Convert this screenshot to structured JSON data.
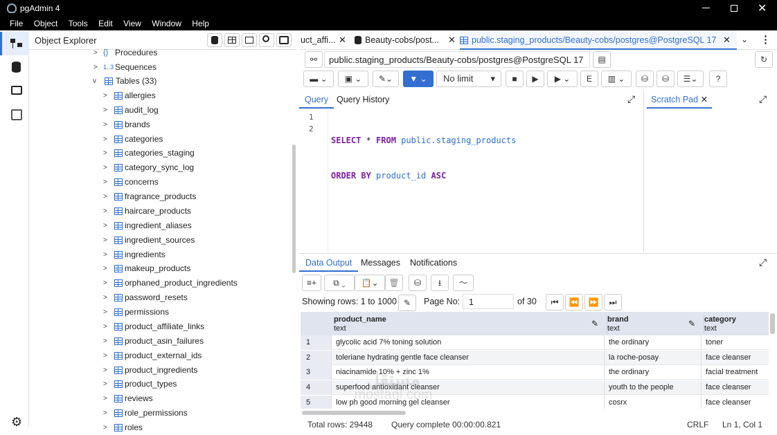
{
  "window": {
    "title": "pgAdmin 4"
  },
  "menu": [
    "File",
    "Object",
    "Tools",
    "Edit",
    "View",
    "Window",
    "Help"
  ],
  "explorer": {
    "title": "Object Explorer",
    "nodes": {
      "procedures": "Procedures",
      "sequences_badge": "1..3",
      "sequences": "Sequences",
      "tables": "Tables (33)"
    },
    "tables": [
      "allergies",
      "audit_log",
      "brands",
      "categories",
      "categories_staging",
      "category_sync_log",
      "concerns",
      "fragrance_products",
      "haircare_products",
      "ingredient_aliases",
      "ingredient_sources",
      "ingredients",
      "makeup_products",
      "orphaned_product_ingredients",
      "password_resets",
      "permissions",
      "product_affiliate_links",
      "product_asin_failures",
      "product_external_ids",
      "product_ingredients",
      "product_types",
      "reviews",
      "role_permissions",
      "roles"
    ]
  },
  "tabs": [
    {
      "label": "uct_affi..."
    },
    {
      "label": "Beauty-cobs/post..."
    },
    {
      "label": "public.staging_products/Beauty-cobs/postgres@PostgreSQL 17"
    }
  ],
  "connection": {
    "label": "public.staging_products/Beauty-cobs/postgres@PostgreSQL 17"
  },
  "toolbar": {
    "limit": "No limit"
  },
  "editor": {
    "tabs": {
      "query": "Query",
      "history": "Query History"
    },
    "line_numbers": [
      "1",
      "2"
    ],
    "line1": {
      "kw1": "SELECT",
      "op": " * ",
      "kw2": "FROM",
      "obj": " public.staging_products"
    },
    "line2": {
      "kw1": "ORDER BY",
      "col": " product_id ",
      "kw2": "ASC"
    }
  },
  "scratch": {
    "title": "Scratch Pad"
  },
  "output": {
    "tabs": {
      "data": "Data Output",
      "messages": "Messages",
      "notifications": "Notifications"
    },
    "showing_label": "Showing rows:",
    "showing_value": "1 to 1000",
    "page_label": "Page No:",
    "page_value": "1",
    "of_pages": "of 30",
    "columns": [
      {
        "name": "product_name",
        "type": "text"
      },
      {
        "name": "brand",
        "type": "text"
      },
      {
        "name": "category",
        "type": "text"
      }
    ],
    "rows": [
      {
        "n": "1",
        "product_name": "glycolic acid 7% toning solution",
        "brand": "the ordinary",
        "category": "toner"
      },
      {
        "n": "2",
        "product_name": "toleriane hydrating gentle face cleanser",
        "brand": "la roche-posay",
        "category": "face cleanser"
      },
      {
        "n": "3",
        "product_name": "niacinamide 10% + zinc 1%",
        "brand": "the ordinary",
        "category": "facial treatment"
      },
      {
        "n": "4",
        "product_name": "superfood antioxidant cleanser",
        "brand": "youth to the people",
        "category": "face cleanser"
      },
      {
        "n": "5",
        "product_name": "low ph good morning gel cleanser",
        "brand": "cosrx",
        "category": "face cleanser"
      }
    ],
    "total_rows": "Total rows: 29448",
    "query_status": "Query complete 00:00:00.821",
    "line_ending": "CRLF",
    "cursor": "Ln 1, Col 1"
  },
  "watermark": {
    "line1": "مستقل",
    "line2": "mostaql.com"
  },
  "colors": {
    "accent": "#326fd1",
    "keyword": "#7a1fa2",
    "object": "#2a6ed8"
  }
}
